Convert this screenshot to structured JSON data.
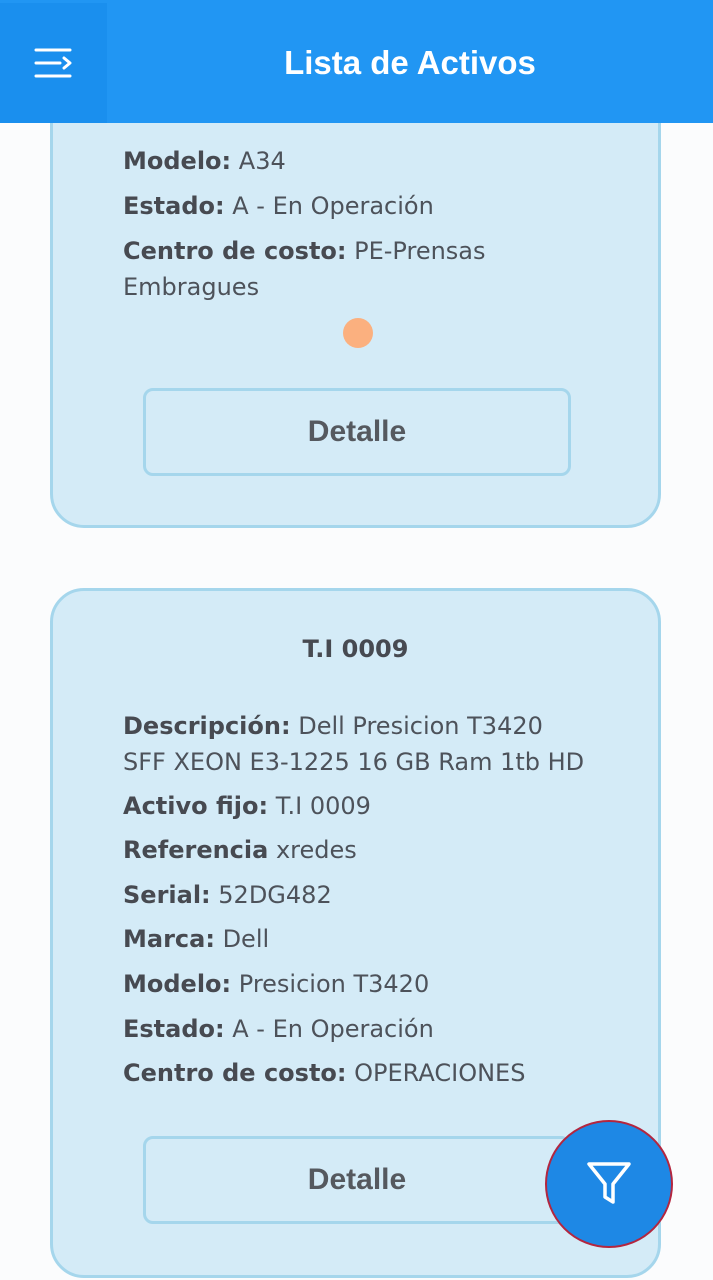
{
  "header": {
    "title": "Lista de Activos",
    "menu_icon": "menu-icon",
    "background": "#2196f3"
  },
  "cards": [
    {
      "fields": [
        {
          "label": "Modelo:",
          "value": " A34"
        },
        {
          "label": "Estado:",
          "value": " A - En Operación"
        },
        {
          "label": "Centro de costo:",
          "value": " PE-Prensas Embragues"
        }
      ],
      "status_dot_color": "#fbb07f",
      "detail_label": "Detalle"
    },
    {
      "title": "T.I 0009",
      "fields": [
        {
          "label": "Descripción:",
          "value": " Dell Presicion T3420 SFF  XEON E3-1225  16 GB Ram 1tb HD"
        },
        {
          "label": "Activo fijo:",
          "value": " T.I 0009"
        },
        {
          "label": "Referencia",
          "value": " xredes"
        },
        {
          "label": "Serial:",
          "value": " 52DG482"
        },
        {
          "label": "Marca:",
          "value": " Dell"
        },
        {
          "label": "Modelo:",
          "value": " Presicion T3420"
        },
        {
          "label": "Estado:",
          "value": " A - En Operación"
        },
        {
          "label": "Centro de costo:",
          "value": " OPERACIONES"
        }
      ],
      "detail_label": "Detalle"
    }
  ],
  "fab": {
    "icon": "filter-icon",
    "color": "#1e88e5"
  }
}
